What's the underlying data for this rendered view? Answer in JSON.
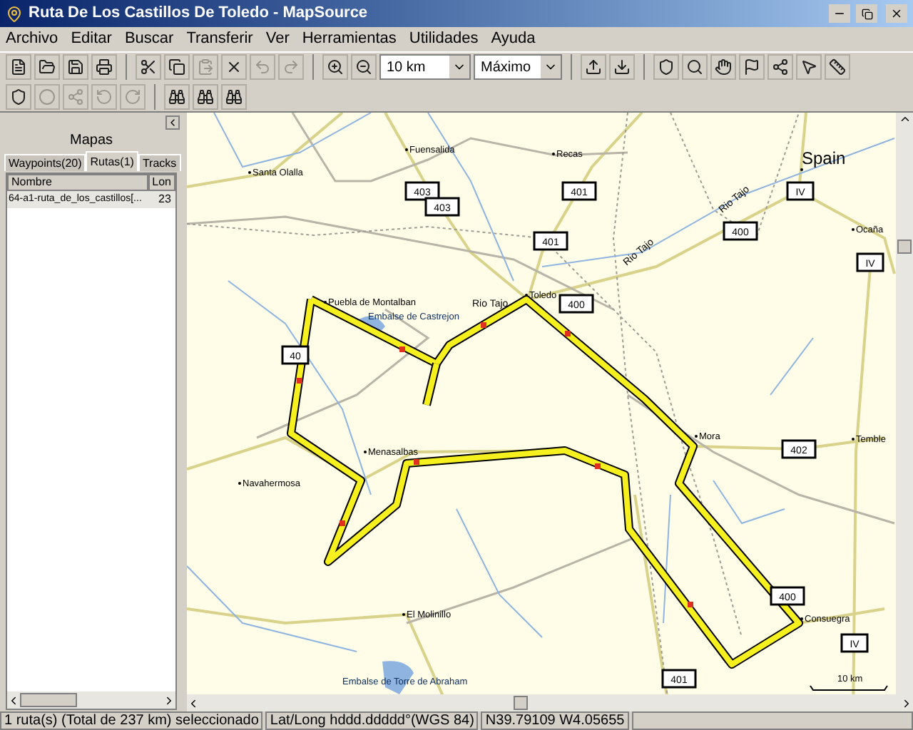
{
  "window": {
    "title": "Ruta De Los Castillos De Toledo - MapSource"
  },
  "menu": [
    "Archivo",
    "Editar",
    "Buscar",
    "Transferir",
    "Ver",
    "Herramientas",
    "Utilidades",
    "Ayuda"
  ],
  "toolbar": {
    "zoom_scale": "10 km",
    "detail": "Máximo"
  },
  "left_panel": {
    "title": "Mapas",
    "tabs": [
      {
        "label": "Waypoints(20)",
        "selected": false
      },
      {
        "label": "Rutas(1)",
        "selected": true
      },
      {
        "label": "Tracks",
        "selected": false
      }
    ],
    "columns": [
      "Nombre",
      "Lon"
    ],
    "rows": [
      {
        "name": "64-a1-ruta_de_los_castillos[...",
        "length": "23",
        "selected": true
      }
    ]
  },
  "map": {
    "places": [
      {
        "name": "Santa Olalla",
        "kind": "town"
      },
      {
        "name": "Fuensalida",
        "kind": "town"
      },
      {
        "name": "Recas",
        "kind": "town"
      },
      {
        "name": "Spain",
        "kind": "country"
      },
      {
        "name": "Ocaña",
        "kind": "town"
      },
      {
        "name": "Rio Tajo",
        "kind": "river"
      },
      {
        "name": "Rio Tajo",
        "kind": "river"
      },
      {
        "name": "Puebla de Montalban",
        "kind": "town"
      },
      {
        "name": "Embalse de Castrejon",
        "kind": "lake"
      },
      {
        "name": "Rio Tajo",
        "kind": "river"
      },
      {
        "name": "Toledo",
        "kind": "town"
      },
      {
        "name": "Mora",
        "kind": "town"
      },
      {
        "name": "Temble",
        "kind": "town"
      },
      {
        "name": "Navahermosa",
        "kind": "town"
      },
      {
        "name": "Menasalbas",
        "kind": "town"
      },
      {
        "name": "Consuegra",
        "kind": "town"
      },
      {
        "name": "El Molinillo",
        "kind": "town"
      },
      {
        "name": "Embalse de Torre de Abraham",
        "kind": "lake"
      }
    ],
    "shields": [
      "403",
      "403",
      "401",
      "IV",
      "401",
      "400",
      "IV",
      "400",
      "40",
      "402",
      "400",
      "IV",
      "401"
    ],
    "scale": "10 km"
  },
  "status_bar": [
    "1 ruta(s) (Total de 237 km) seleccionado",
    "Lat/Long hddd.ddddd°(WGS 84)",
    "N39.79109 W4.05655"
  ]
}
